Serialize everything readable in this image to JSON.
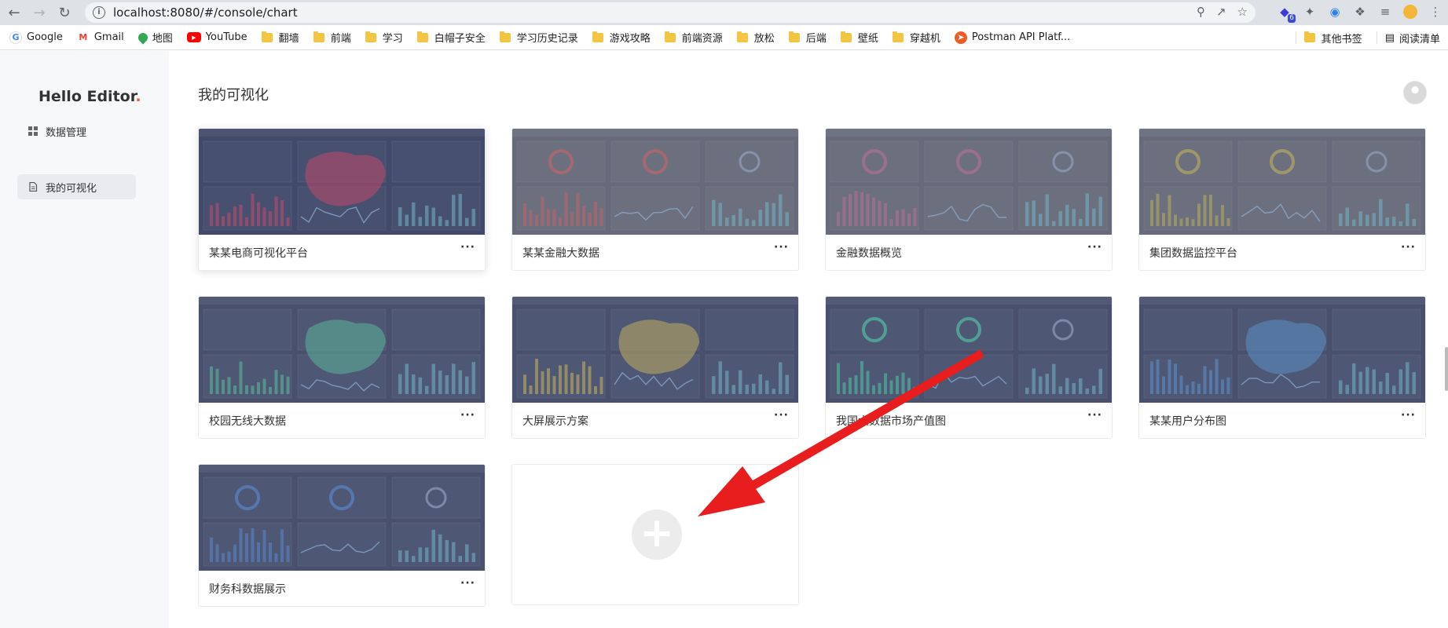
{
  "browser": {
    "url": "localhost:8080/#/console/chart",
    "extension_badge": "6",
    "bookmarks": [
      {
        "label": "Google",
        "icon": "google-logo"
      },
      {
        "label": "Gmail",
        "icon": "gmail-logo"
      },
      {
        "label": "地图",
        "icon": "maps-logo"
      },
      {
        "label": "YouTube",
        "icon": "youtube-logo"
      },
      {
        "label": "翻墙",
        "icon": "folder-icon"
      },
      {
        "label": "前端",
        "icon": "folder-icon"
      },
      {
        "label": "学习",
        "icon": "folder-icon"
      },
      {
        "label": "白帽子安全",
        "icon": "folder-icon"
      },
      {
        "label": "学习历史记录",
        "icon": "folder-icon"
      },
      {
        "label": "游戏攻略",
        "icon": "folder-icon"
      },
      {
        "label": "前端资源",
        "icon": "folder-icon"
      },
      {
        "label": "放松",
        "icon": "folder-icon"
      },
      {
        "label": "后端",
        "icon": "folder-icon"
      },
      {
        "label": "壁纸",
        "icon": "folder-icon"
      },
      {
        "label": "穿越机",
        "icon": "folder-icon"
      },
      {
        "label": "Postman API Platf...",
        "icon": "postman-logo"
      }
    ],
    "other_bookmarks": "其他书签",
    "reading_list": "阅读清单"
  },
  "sidebar": {
    "brand": "Hello Editor",
    "brand_dot": ".",
    "items": [
      {
        "label": "数据管理",
        "icon": "grid-icon",
        "active": false
      },
      {
        "label": "我的可视化",
        "icon": "document-icon",
        "active": true
      }
    ]
  },
  "main": {
    "title": "我的可视化",
    "cards": [
      {
        "title": "某某电商可视化平台",
        "theme": "ecommerce",
        "accent": "#e8305a"
      },
      {
        "title": "某某金融大数据",
        "theme": "finance",
        "accent": "#e05a5a"
      },
      {
        "title": "金融数据概览",
        "theme": "overview",
        "accent": "#d06a9a"
      },
      {
        "title": "集团数据监控平台",
        "theme": "monitor",
        "accent": "#d6c24a"
      },
      {
        "title": "校园无线大数据",
        "theme": "campus",
        "accent": "#4ad6a0"
      },
      {
        "title": "大屏展示方案",
        "theme": "screen",
        "accent": "#e8c84a"
      },
      {
        "title": "我国大数据市场产值图",
        "theme": "market",
        "accent": "#3ee0b0"
      },
      {
        "title": "某某用户分布图",
        "theme": "users",
        "accent": "#4a9ae8"
      },
      {
        "title": "财务科数据展示",
        "theme": "accounting",
        "accent": "#4a8ae8"
      }
    ],
    "add_label": "+"
  }
}
